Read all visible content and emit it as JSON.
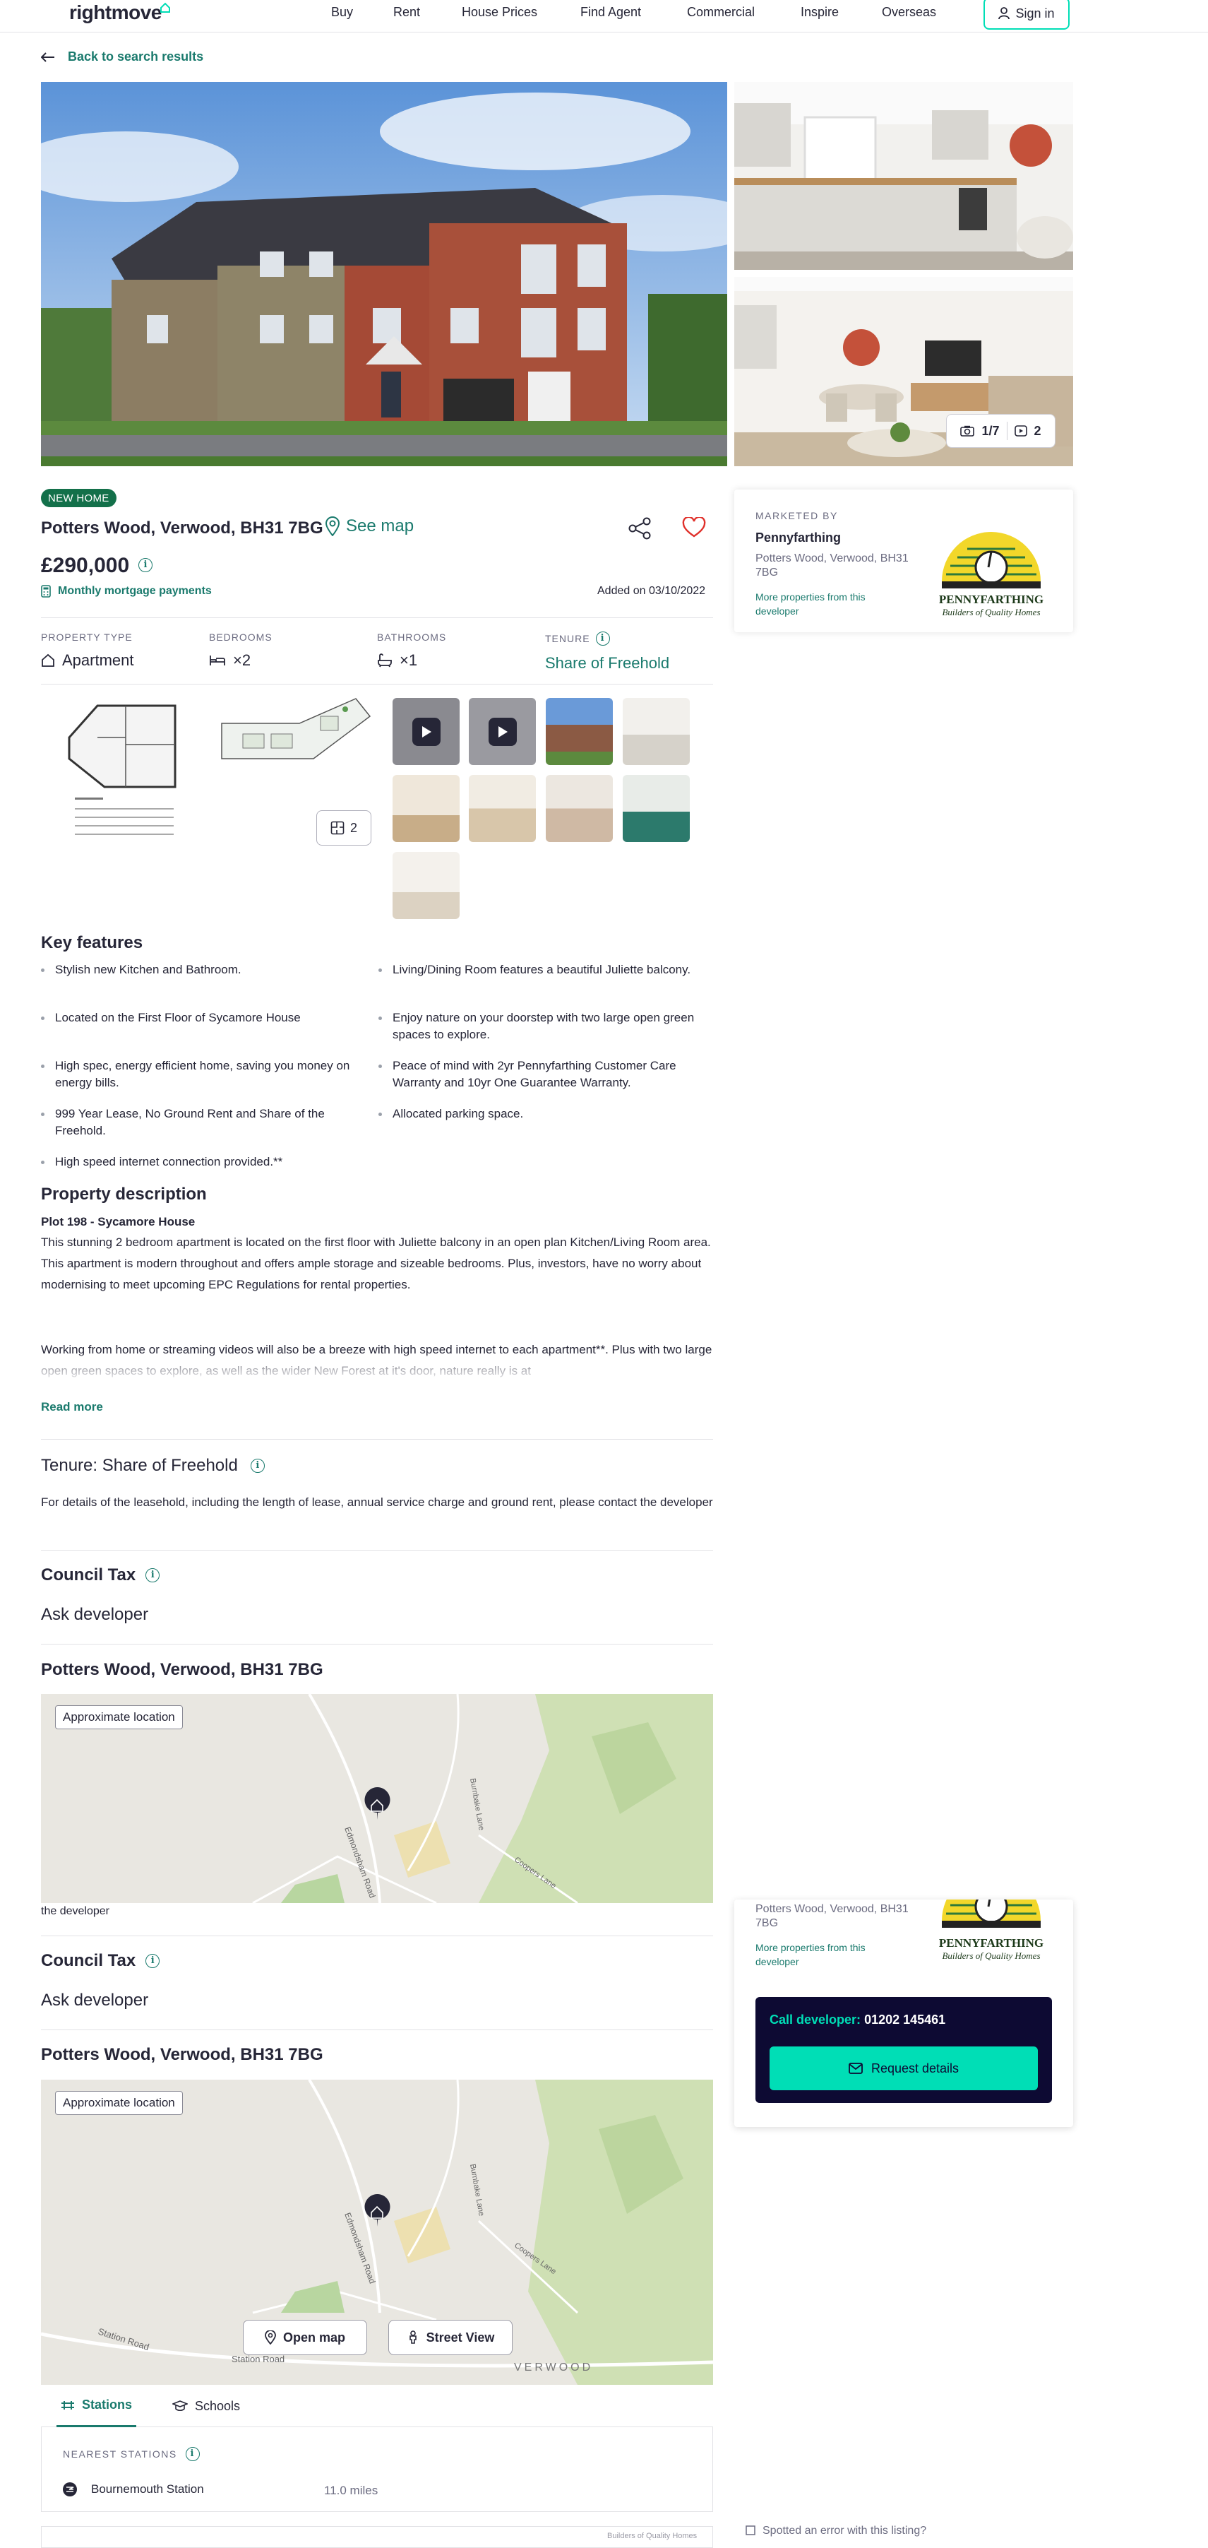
{
  "header": {
    "logo": "rightmove",
    "nav": [
      "Buy",
      "Rent",
      "House Prices",
      "Find Agent",
      "Commercial",
      "Inspire",
      "Overseas"
    ],
    "sign_in": "Sign in"
  },
  "back_link": "Back to search results",
  "gallery": {
    "photo_count": "1/7",
    "video_count": "2"
  },
  "listing": {
    "badge": "NEW HOME",
    "address": "Potters Wood, Verwood, BH31 7BG",
    "see_map": "See map",
    "price": "£290,000",
    "mortgage_link": "Monthly mortgage payments",
    "added": "Added on 03/10/2022"
  },
  "facts": {
    "property_type_label": "PROPERTY TYPE",
    "property_type_value": "Apartment",
    "bedrooms_label": "BEDROOMS",
    "bedrooms_value": "×2",
    "bathrooms_label": "BATHROOMS",
    "bathrooms_value": "×1",
    "tenure_label": "TENURE",
    "tenure_value": "Share of Freehold"
  },
  "floorplan_count": "2",
  "key_features": {
    "title": "Key features",
    "items": [
      "Stylish new Kitchen and Bathroom.",
      "Living/Dining Room features a beautiful Juliette balcony.",
      "Located on the First Floor of Sycamore House",
      "Enjoy nature on your doorstep with two large open green spaces to explore.",
      "High spec, energy efficient home, saving you money on energy bills.",
      "Peace of mind with 2yr Pennyfarthing Customer Care Warranty and 10yr One Guarantee Warranty.",
      "999 Year Lease, No Ground Rent and Share of the Freehold.",
      "Allocated parking space.",
      "High speed internet connection provided.**"
    ]
  },
  "description": {
    "title": "Property description",
    "subtitle": "Plot 198 - Sycamore House",
    "para1": "This stunning 2 bedroom apartment is located on the first floor with Juliette balcony in an open plan Kitchen/Living Room area. This apartment is modern throughout and offers ample storage and sizeable bedrooms. Plus, investors, have no worry about modernising to meet upcoming EPC Regulations for rental properties.",
    "para2": "Working from home or streaming videos will also be a breeze with high speed internet to each apartment**. Plus with two large open green spaces to explore, as well as the wider New Forest at it's door, nature really is at",
    "read_more": "Read more"
  },
  "tenure_section": {
    "title": "Tenure: Share of Freehold",
    "text": "For details of the leasehold, including the length of lease, annual service charge and ground rent, please contact the developer",
    "overlap_text": "the developer"
  },
  "council_tax": {
    "title": "Council Tax",
    "value": "Ask developer"
  },
  "location": {
    "title": "Potters Wood, Verwood, BH31 7BG",
    "approx": "Approximate location",
    "open_map": "Open map",
    "street_view": "Street View",
    "map_labels": [
      "Edmondsham Road",
      "Burnbake Lane",
      "Coopers Lane",
      "Station Road",
      "VERWOOD"
    ]
  },
  "agent": {
    "marketed_by": "MARKETED BY",
    "name": "Pennyfarthing",
    "address": "Potters Wood, Verwood, BH31 7BG",
    "more": "More properties from this developer",
    "logo_text": "PENNYFARTHING",
    "logo_tagline": "Builders of Quality Homes",
    "call_label": "Call developer:",
    "phone": "01202 145461",
    "request": "Request details"
  },
  "stations": {
    "tab_stations": "Stations",
    "tab_schools": "Schools",
    "label": "NEAREST STATIONS",
    "items": [
      {
        "name": "Bournemouth Station",
        "distance": "11.0 miles"
      }
    ]
  },
  "footer": {
    "caption": "Builders of Quality Homes",
    "error_link": "Spotted an error with this listing?"
  },
  "colors": {
    "brand": "#00deb6",
    "link": "#1a7a6d",
    "badge": "#13704a",
    "text": "#262637",
    "call_bg": "#0d0a33"
  }
}
